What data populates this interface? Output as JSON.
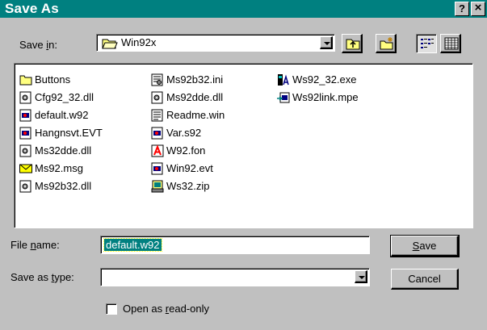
{
  "window": {
    "title": "Save As",
    "help_label": "?",
    "close_label": "×"
  },
  "save_in": {
    "label_pre": "Save ",
    "label_key": "i",
    "label_post": "n:",
    "value": "Win92x"
  },
  "files": [
    {
      "name": "Buttons",
      "icon": "folder-icon"
    },
    {
      "name": "Cfg92_32.dll",
      "icon": "dll-file-icon"
    },
    {
      "name": "default.w92",
      "icon": "w92-file-icon"
    },
    {
      "name": "Hangnsvt.EVT",
      "icon": "evt-file-icon"
    },
    {
      "name": "Ms32dde.dll",
      "icon": "dll-file-icon"
    },
    {
      "name": "Ms92.msg",
      "icon": "msg-file-icon"
    },
    {
      "name": "Ms92b32.dll",
      "icon": "dll-file-icon"
    },
    {
      "name": "Ms92b32.ini",
      "icon": "ini-file-icon"
    },
    {
      "name": "Ms92dde.dll",
      "icon": "dll-file-icon"
    },
    {
      "name": "Readme.win",
      "icon": "text-file-icon"
    },
    {
      "name": "Var.s92",
      "icon": "s92-file-icon"
    },
    {
      "name": "W92.fon",
      "icon": "font-file-icon"
    },
    {
      "name": "Win92.evt",
      "icon": "evt-file-icon"
    },
    {
      "name": "Ws32.zip",
      "icon": "zip-file-icon"
    },
    {
      "name": "Ws92_32.exe",
      "icon": "exe-file-icon"
    },
    {
      "name": "Ws92link.mpe",
      "icon": "mpe-file-icon"
    }
  ],
  "file_name": {
    "label_pre": "File ",
    "label_key": "n",
    "label_post": "ame:",
    "value": "default.w92"
  },
  "save_type": {
    "label_pre": "Save as ",
    "label_key": "t",
    "label_post": "ype:",
    "value": ""
  },
  "buttons": {
    "save_key": "S",
    "save_rest": "ave",
    "cancel": "Cancel"
  },
  "read_only": {
    "label_pre": "Open as ",
    "label_key": "r",
    "label_post": "ead-only",
    "checked": false
  }
}
